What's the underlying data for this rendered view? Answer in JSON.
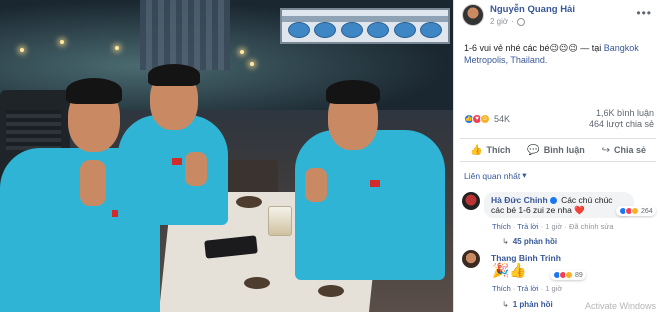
{
  "post": {
    "author": "Nguyễn Quang Hải",
    "time": "2 giờ",
    "text": "1-6 vui vẻ nhé các bé😉😉😉",
    "location_prefix": " — tại ",
    "location": "Bangkok Metropolis, Thailand."
  },
  "reactions": {
    "count": "54K",
    "comments": "1,6K bình luận",
    "shares": "464 lượt chia sẻ"
  },
  "actions": {
    "like": "Thích",
    "comment": "Bình luận",
    "share": "Chia sẻ"
  },
  "comments_filter": "Liên quan nhất",
  "comments": [
    {
      "name": "Hà Đức Chinh",
      "text": "Các chú chúc các bé 1-6 zui ze nha",
      "reaction_count": "264",
      "actions": [
        "Thích",
        "Trả lời",
        "1 giờ",
        "Đã chỉnh sửa"
      ],
      "replies": "45 phản hồi"
    },
    {
      "name": "Thang Binh Trinh",
      "reaction_count": "89",
      "actions": [
        "Thích",
        "Trả lời",
        "1 giờ"
      ],
      "replies": "1 phản hồi"
    }
  ],
  "watermark": "Activate Windows",
  "icons": {
    "more": "more-options-icon",
    "globe": "globe-icon",
    "like": "thumbs-up-icon",
    "comment": "speech-bubble-icon",
    "share": "share-arrow-icon"
  },
  "colors": {
    "brand": "#385898",
    "like": "#1877f2",
    "shirt": "#2fb4d6"
  }
}
